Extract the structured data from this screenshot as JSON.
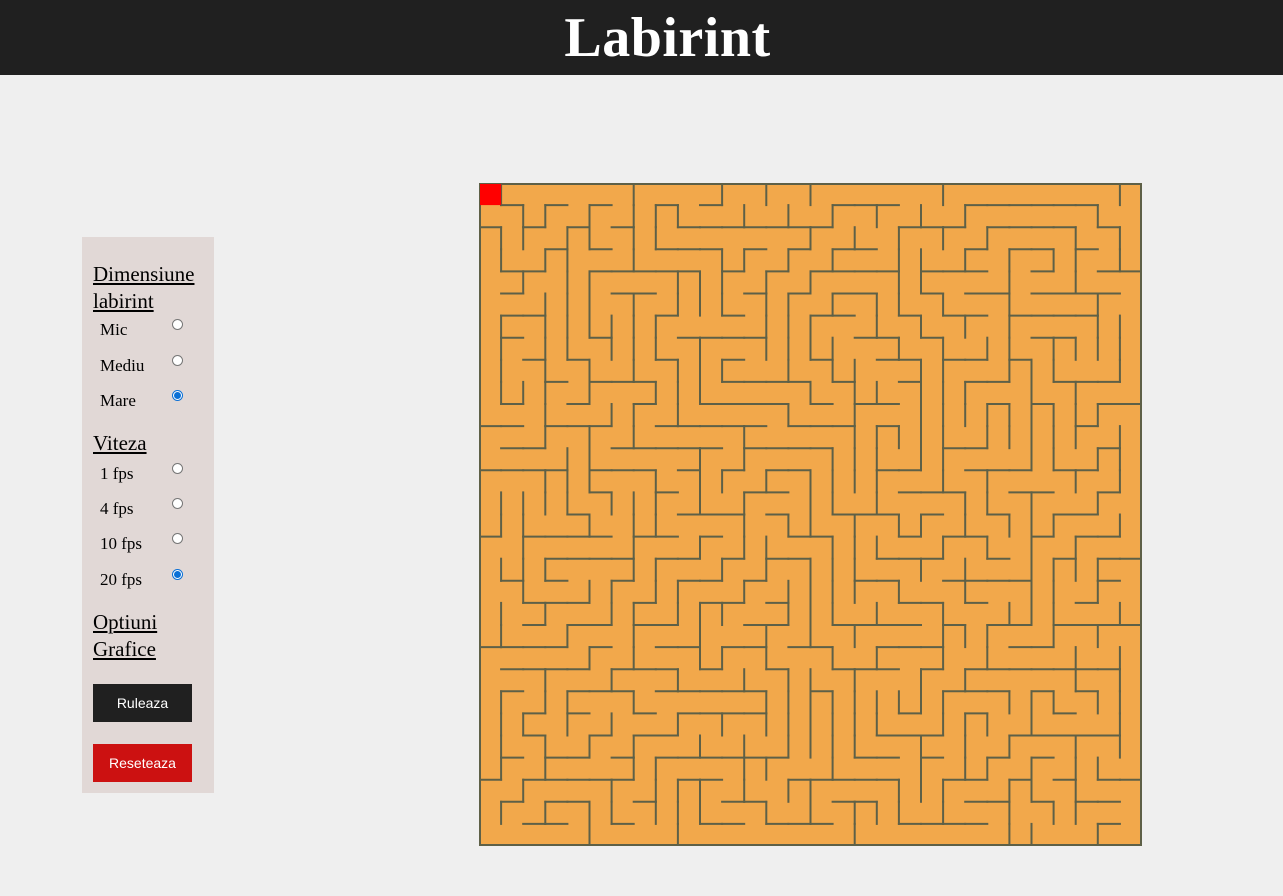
{
  "header": {
    "title": "Labirint"
  },
  "panel": {
    "size_section": {
      "title": "Dimensiune labirint",
      "options": [
        {
          "label": "Mic",
          "checked": false
        },
        {
          "label": "Mediu",
          "checked": false
        },
        {
          "label": "Mare",
          "checked": true
        }
      ]
    },
    "speed_section": {
      "title": "Viteza",
      "options": [
        {
          "label": "1 fps",
          "checked": false
        },
        {
          "label": "4 fps",
          "checked": false
        },
        {
          "label": "10 fps",
          "checked": false
        },
        {
          "label": "20 fps",
          "checked": true
        }
      ]
    },
    "graphics_section": {
      "title": "Optiuni Grafice"
    },
    "run_button": "Ruleaza",
    "reset_button": "Reseteaza"
  },
  "maze": {
    "grid_cells": 30,
    "start_cell": [
      0,
      0
    ],
    "colors": {
      "background": "#f2a84b",
      "wall": "#5e6047",
      "player": "#ff0000",
      "border": "#5e6047"
    }
  }
}
